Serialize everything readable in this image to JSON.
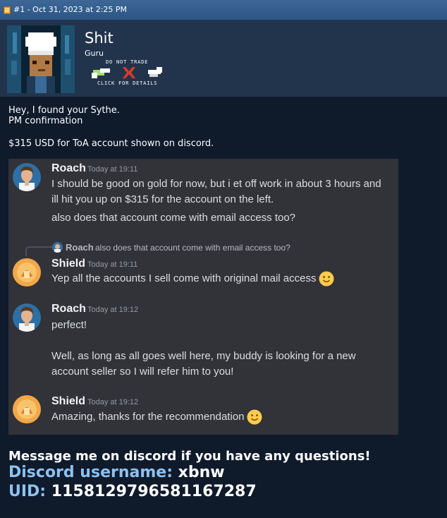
{
  "post": {
    "meta": "#1 - Oct 31, 2023 at 2:25 PM",
    "username": "Shit",
    "user_title": "Guru",
    "badge": {
      "top_text": "DO NOT TRADE",
      "bottom_text": "CLICK FOR DETAILS"
    }
  },
  "body": {
    "line1": "Hey, I found your Sythe.",
    "line2": "PM confirmation",
    "line3": "$315 USD for ToA account shown on discord."
  },
  "discord": {
    "messages": [
      {
        "author": "Roach",
        "time": "Today at 19:11",
        "lines": [
          "I should be good on gold for now, but i et off work in about 3 hours and",
          "ill hit you up on $315 for the account on the left.",
          "also does that account come with email access too?"
        ]
      },
      {
        "reply_author": "Roach",
        "reply_text": "also does that account come with email access too?",
        "author": "Shield",
        "time": "Today at 19:11",
        "lines": [
          "Yep all the accounts I sell come with original mail access"
        ]
      },
      {
        "author": "Roach",
        "time": "Today at 19:12",
        "lines": [
          "perfect!",
          "Well, as long as all goes well here, my buddy is looking for a new",
          "account seller so I will refer him to you!"
        ]
      },
      {
        "author": "Shield",
        "time": "Today at 19:12",
        "lines": [
          "Amazing, thanks for the recommendation"
        ]
      }
    ]
  },
  "footer": {
    "message": "Message me on discord if you have any questions!",
    "discord_label": "Discord username:",
    "discord_value": "xbnw",
    "uid_label": "UID:",
    "uid_value": "1158129796581167287"
  },
  "colors": {
    "page_bg": "#0f1a2b",
    "header_bar": "#2c5584",
    "discord_bg": "#313338",
    "label_blue": "#8ec1f0"
  },
  "icons": [
    "post-icon",
    "avatar",
    "do-not-trade-badge",
    "slightly-smiling-face-emoji"
  ]
}
